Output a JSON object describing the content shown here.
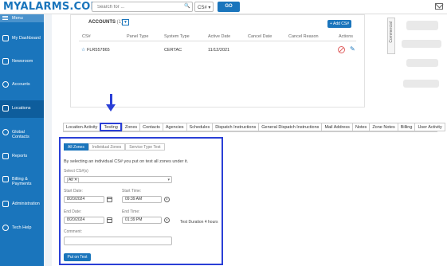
{
  "header": {
    "logo": "MYALARMS.COM",
    "search_placeholder": "Search for ...",
    "search_type": "CS#",
    "go_label": "GO"
  },
  "sidebar": {
    "menu_label": "Menu",
    "items": [
      {
        "label": "My Dashboard",
        "icon": "dashboard-icon"
      },
      {
        "label": "Newsroom",
        "icon": "newsroom-icon"
      },
      {
        "label": "Accounts",
        "icon": "accounts-icon"
      },
      {
        "label": "Locations",
        "icon": "locations-icon"
      },
      {
        "label": "Global Contacts",
        "icon": "contacts-icon"
      },
      {
        "label": "Reports",
        "icon": "reports-icon"
      },
      {
        "label": "Billing & Payments",
        "icon": "billing-icon"
      },
      {
        "label": "Administration",
        "icon": "admin-icon"
      },
      {
        "label": "Tech Help",
        "icon": "help-icon"
      }
    ],
    "active_item": "Locations"
  },
  "accounts": {
    "title": "ACCOUNTS",
    "count": "(1)",
    "add_label": "+ Add CS#",
    "columns": [
      "CS#",
      "Panel Type",
      "System Type",
      "Active Date",
      "Cancel Date",
      "Cancel Reason",
      "Actions"
    ],
    "rows": [
      {
        "cs": "FLR557865",
        "panel_type": "",
        "system_type": "CERTAC",
        "active_date": "11/12/2021",
        "cancel_date": "",
        "cancel_reason": ""
      }
    ],
    "commercial_label": "Commercial"
  },
  "tabs": {
    "items": [
      "Location Activity",
      "Testing",
      "Zones",
      "Contacts",
      "Agencies",
      "Schedules",
      "Dispatch Instructions",
      "General Dispatch Instructions",
      "Mail Address",
      "Notes",
      "Zone Notes",
      "Billing",
      "User Activity"
    ],
    "active": "Testing"
  },
  "testing": {
    "subtabs": [
      "All Zones",
      "Individual Zones",
      "Service Type Test"
    ],
    "active_subtab": "All Zones",
    "description": "By selecting an individual CS# you put on test all zones under it.",
    "select_label": "Select CS#(s)",
    "select_chip": "All",
    "start_date_label": "Start Date:",
    "start_date": "8/20/2024",
    "start_time_label": "Start Time:",
    "start_time": "09:39 AM",
    "end_date_label": "End Date:",
    "end_date": "8/20/2024",
    "end_time_label": "End Time:",
    "end_time": "01:39 PM",
    "duration": "Test Duration 4 hours",
    "comment_label": "Comment:",
    "comment_value": "",
    "put_label": "Put on Test"
  },
  "colors": {
    "brand": "#1a75bc",
    "highlight": "#2a3fd6"
  }
}
